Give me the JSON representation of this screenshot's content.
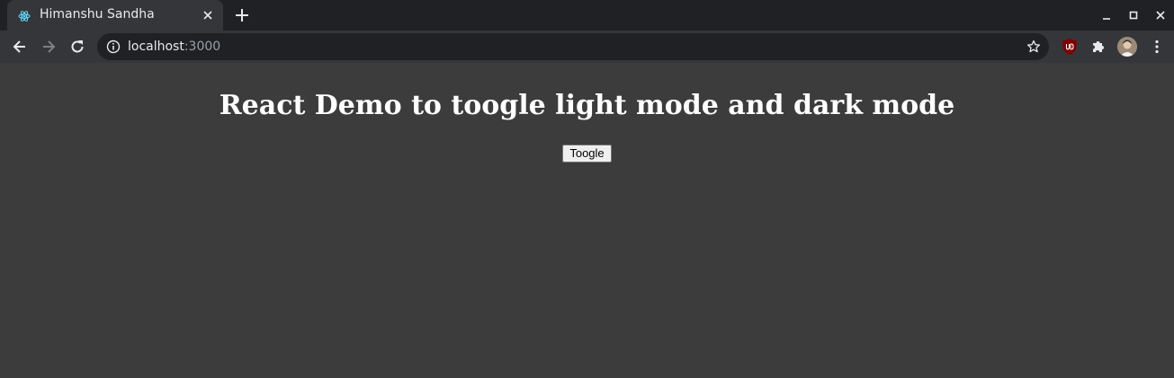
{
  "browser": {
    "tab": {
      "title": "Himanshu Sandha",
      "favicon": "react-logo-icon"
    },
    "address_bar": {
      "host": "localhost",
      "port": ":3000"
    }
  },
  "page": {
    "heading": "React Demo to toogle light mode and dark mode",
    "toggle_label": "Toogle"
  },
  "colors": {
    "tabstrip_bg": "#202124",
    "toolbar_bg": "#35363a",
    "page_bg": "#3c3c3c",
    "text_primary": "#e8eaed"
  }
}
